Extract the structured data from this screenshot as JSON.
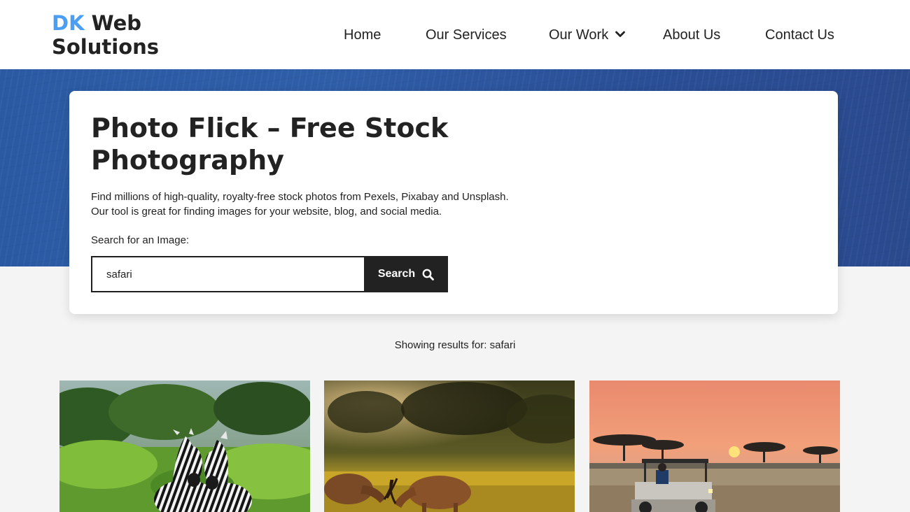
{
  "brand": {
    "logo_part1": "DK",
    "logo_part2": "Web",
    "logo_line2": "Solutions",
    "accent_color": "#4a9ff5"
  },
  "nav": {
    "items": [
      {
        "label": "Home"
      },
      {
        "label": "Our Services"
      },
      {
        "label": "Our Work",
        "has_dropdown": true,
        "icon": "chevron-down-icon"
      },
      {
        "label": "About Us"
      },
      {
        "label": "Contact Us"
      }
    ]
  },
  "hero": {
    "title": "Photo Flick – Free Stock Photography",
    "description": "Find millions of high-quality, royalty-free stock photos from Pexels, Pixabay and Unsplash. Our tool is great for finding images for your website, blog, and social media.",
    "search_label": "Search for an Image:",
    "search_value": "safari",
    "search_button": "Search",
    "search_icon": "search-icon"
  },
  "results": {
    "text": "Showing results for: safari",
    "photos": [
      {
        "subject": "two zebras in green grass"
      },
      {
        "subject": "two antelopes grazing at sunset"
      },
      {
        "subject": "safari jeep on savanna at sunset"
      }
    ]
  }
}
